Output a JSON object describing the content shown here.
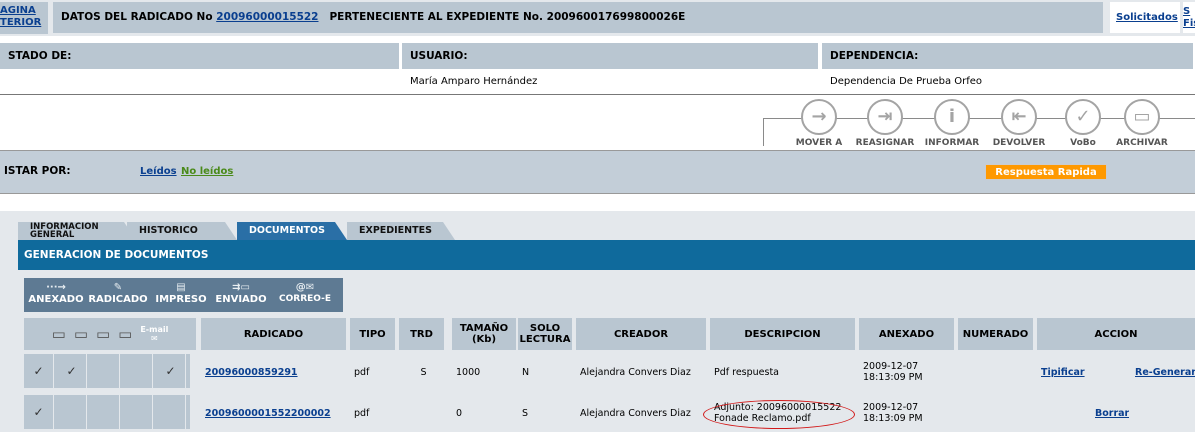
{
  "topbar": {
    "prev_line1": "AGINA",
    "prev_line2": "TERIOR",
    "radicado_label": "DATOS DEL RADICADO No",
    "radicado_number": "20096000015522",
    "expediente_text": "PERTENECIENTE AL EXPEDIENTE No. 200960017699800026E",
    "solicitados": "Solicitados",
    "fis_line1": "S",
    "fis_line2": "Fis"
  },
  "info": {
    "estado_label": "STADO DE:",
    "usuario_label": "USUARIO:",
    "usuario_value": "María Amparo Hernández",
    "dependencia_label": "DEPENDENCIA:",
    "dependencia_value": "Dependencia De Prueba Orfeo"
  },
  "actions": [
    {
      "label": "MOVER A",
      "icon": "arrow-right-icon",
      "glyph": "→"
    },
    {
      "label": "REASIGNAR",
      "icon": "reassign-icon",
      "glyph": "⇥"
    },
    {
      "label": "INFORMAR",
      "icon": "info-icon",
      "glyph": "i"
    },
    {
      "label": "DEVOLVER",
      "icon": "return-icon",
      "glyph": "⇤"
    },
    {
      "label": "VoBo",
      "icon": "check-icon",
      "glyph": "✓"
    },
    {
      "label": "ARCHIVAR",
      "icon": "archive-icon",
      "glyph": "▭"
    }
  ],
  "listar": {
    "label": "ISTAR POR:",
    "leidos": "Leídos",
    "no_leidos": "No leídos",
    "respuesta_rapida": "Respuesta Rapida"
  },
  "tabs": [
    {
      "label": "INFORMACION GENERAL",
      "active": false
    },
    {
      "label": "HISTORICO",
      "active": false
    },
    {
      "label": "DOCUMENTOS",
      "active": true
    },
    {
      "label": "EXPEDIENTES",
      "active": false
    }
  ],
  "section_title": "GENERACION DE DOCUMENTOS",
  "doc_buttons": [
    {
      "label": "ANEXADO",
      "icon": "dotted-arrow-icon"
    },
    {
      "label": "RADICADO",
      "icon": "pen-icon"
    },
    {
      "label": "IMPRESO",
      "icon": "printer-icon"
    },
    {
      "label": "ENVIADO",
      "icon": "send-icon"
    },
    {
      "label": "CORREO-E",
      "icon": "email-icon"
    }
  ],
  "table": {
    "email_icon_label": "E-mail",
    "headers": {
      "radicado": "RADICADO",
      "tipo": "TIPO",
      "trd": "TRD",
      "tamano": "TAMAÑO (Kb)",
      "solo_lectura": "SOLO LECTURA",
      "creador": "CREADOR",
      "descripcion": "DESCRIPCION",
      "anexado": "ANEXADO",
      "numerado": "NUMERADO",
      "accion": "ACCION"
    },
    "rows": [
      {
        "checks": [
          "✓",
          "✓",
          "",
          "",
          "✓"
        ],
        "radicado": "20096000859291",
        "tipo": "pdf",
        "trd": "S",
        "tamano": "1000",
        "solo_lectura": "N",
        "creador": "Alejandra Convers Diaz",
        "descripcion_line1": "Pdf respuesta",
        "descripcion_line2": "",
        "anexado_date": "2009-12-07",
        "anexado_time": "18:13:09 PM",
        "numerado": "",
        "action1": "Tipificar",
        "action2": "",
        "action3": "Re-Generar"
      },
      {
        "checks": [
          "✓",
          "",
          "",
          "",
          ""
        ],
        "radicado": "2009600001552200002",
        "tipo": "pdf",
        "trd": "",
        "tamano": "0",
        "solo_lectura": "S",
        "creador": "Alejandra Convers Diaz",
        "descripcion_line1": "Adjunto: 20096000015522",
        "descripcion_line2": "Fonade Reclamo.pdf",
        "anexado_date": "2009-12-07",
        "anexado_time": "18:13:09 PM",
        "numerado": "",
        "action1": "",
        "action2": "Borrar",
        "action3": ""
      }
    ]
  }
}
